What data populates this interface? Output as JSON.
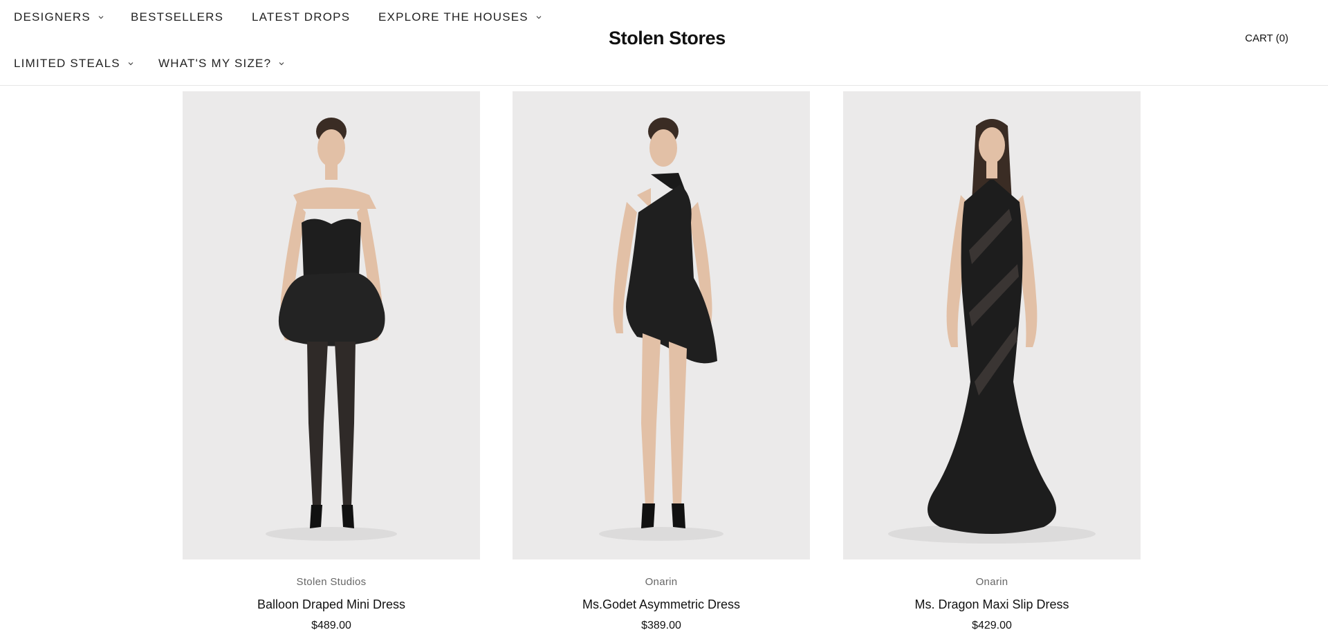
{
  "header": {
    "nav": [
      {
        "label": "DESIGNERS",
        "has_dropdown": true
      },
      {
        "label": "BESTSELLERS",
        "has_dropdown": false
      },
      {
        "label": "LATEST DROPS",
        "has_dropdown": false
      },
      {
        "label": "EXPLORE THE HOUSES",
        "has_dropdown": true
      },
      {
        "label": "LIMITED STEALS",
        "has_dropdown": true
      },
      {
        "label": "WHAT'S MY SIZE?",
        "has_dropdown": true
      }
    ],
    "logo": "Stolen Stores",
    "cart_label": "CART (0)"
  },
  "products": [
    {
      "brand": "Stolen Studios",
      "name": "Balloon Draped Mini Dress",
      "price": "$489.00",
      "image": "model-black-strapless-balloon-mini-dress"
    },
    {
      "brand": "Onarin",
      "name": "Ms.Godet Asymmetric Dress",
      "price": "$389.00",
      "image": "model-black-halter-asymmetric-dress"
    },
    {
      "brand": "Onarin",
      "name": "Ms. Dragon Maxi Slip Dress",
      "price": "$429.00",
      "image": "model-black-sheer-maxi-slip-dress"
    }
  ],
  "colors": {
    "image_background": "#ebeaea",
    "dress": "#1c1c1c",
    "skin": "#e2c0a6"
  }
}
